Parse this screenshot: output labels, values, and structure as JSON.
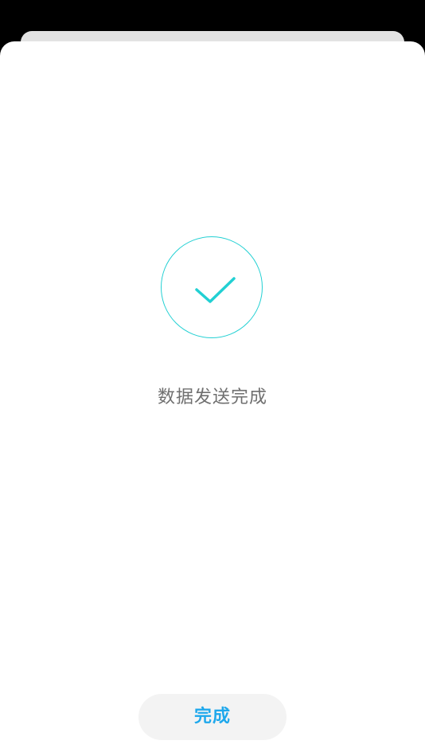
{
  "status": {
    "icon": "checkmark-circle-icon",
    "message": "数据发送完成"
  },
  "actions": {
    "done_label": "完成"
  },
  "colors": {
    "accent_teal": "#22d0d3",
    "button_text_blue": "#1ea8ec",
    "message_gray": "#6f6f6f",
    "button_bg": "#f3f3f3"
  }
}
